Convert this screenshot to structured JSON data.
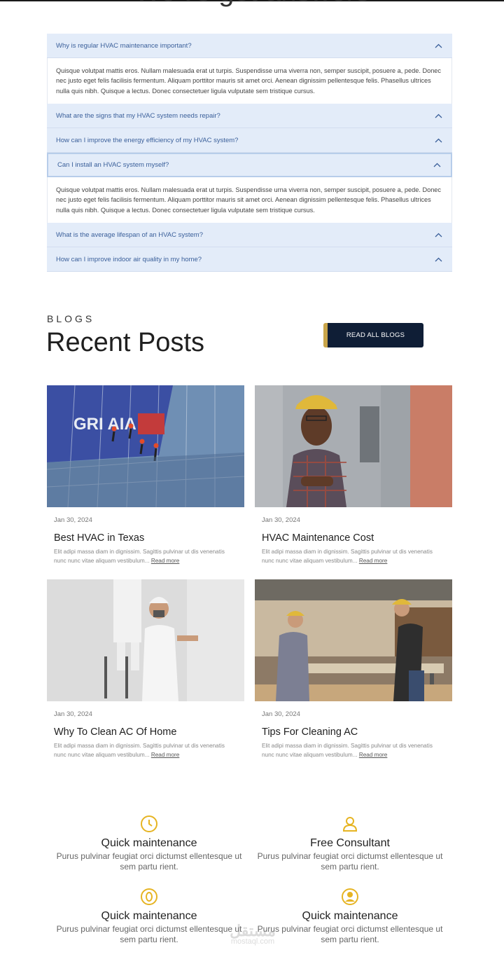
{
  "faq": {
    "heading_fragment": "We've got answers",
    "items": [
      {
        "question": "Why is regular HVAC maintenance important?",
        "answer": "Quisque volutpat mattis eros. Nullam malesuada erat ut turpis. Suspendisse urna viverra non, semper suscipit, posuere a, pede. Donec nec justo eget felis facilisis fermentum. Aliquam porttitor mauris sit amet orci. Aenean dignissim pellentesque felis. Phasellus ultrices nulla quis nibh. Quisque a lectus. Donec consectetuer ligula vulputate sem tristique cursus."
      },
      {
        "question": "What are the signs that my HVAC system needs repair?"
      },
      {
        "question": "How can I improve the energy efficiency of my HVAC system?"
      },
      {
        "question": "Can I install an HVAC system myself?",
        "answer": "Quisque volutpat mattis eros. Nullam malesuada erat ut turpis. Suspendisse urna viverra non, semper suscipit, posuere a, pede. Donec nec justo eget felis facilisis fermentum. Aliquam porttitor mauris sit amet orci. Aenean dignissim pellentesque felis. Phasellus ultrices nulla quis nibh. Quisque a lectus. Donec consectetuer ligula vulputate sem tristique cursus."
      },
      {
        "question": "What is the average lifespan of an HVAC system?"
      },
      {
        "question": "How can I improve indoor air quality in my home?"
      }
    ]
  },
  "blog": {
    "eyebrow": "BLOGS",
    "title": "Recent Posts",
    "read_all_label": "READ ALL BLOGS",
    "read_more_label": "Read more",
    "posts": [
      {
        "date": "Jan 30, 2024",
        "title": "Best HVAC in Texas",
        "excerpt": "Elit adipi massa diam in dignissim. Sagittis pulvinar ut dis venenatis nunc nunc vitae aliquam vestibulum..."
      },
      {
        "date": "Jan 30, 2024",
        "title": "HVAC Maintenance Cost",
        "excerpt": "Elit adipi massa diam in dignissim. Sagittis pulvinar ut dis venenatis nunc nunc vitae aliquam vestibulum..."
      },
      {
        "date": "Jan 30, 2024",
        "title": "Why To Clean AC Of Home",
        "excerpt": "Elit adipi massa diam in dignissim. Sagittis pulvinar ut dis venenatis nunc nunc vitae aliquam vestibulum..."
      },
      {
        "date": "Jan 30, 2024",
        "title": "Tips For Cleaning AC",
        "excerpt": "Elit adipi massa diam in dignissim. Sagittis pulvinar ut dis venenatis nunc nunc vitae aliquam vestibulum..."
      }
    ],
    "image_sign_text": "GRI AIA"
  },
  "features": [
    {
      "icon": "clock-icon",
      "title": "Quick maintenance",
      "desc": "Purus pulvinar feugiat orci dictumst ellentesque ut sem partu rient."
    },
    {
      "icon": "user-icon",
      "title": "Free Consultant",
      "desc": "Purus pulvinar feugiat orci dictumst ellentesque ut sem partu rient."
    },
    {
      "icon": "coin-icon",
      "title": "Quick maintenance",
      "desc": "Purus pulvinar feugiat orci dictumst ellentesque ut sem partu rient."
    },
    {
      "icon": "user-circle-icon",
      "title": "Quick maintenance",
      "desc": "Purus pulvinar feugiat orci dictumst ellentesque ut sem partu rient."
    }
  ],
  "watermark": {
    "arabic": "مستقل",
    "latin": "mostaql.com"
  },
  "colors": {
    "accent": "#e6b422",
    "faq_bg": "#e3ecf9",
    "faq_text": "#3a5f9a",
    "button_bg": "#0f1e36",
    "button_stripe": "#c9a54a"
  }
}
